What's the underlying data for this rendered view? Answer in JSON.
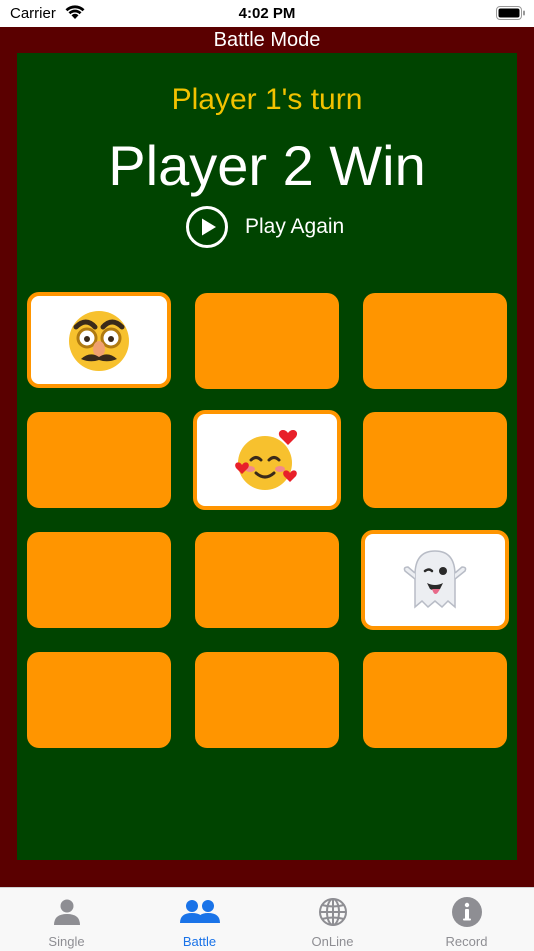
{
  "status_bar": {
    "carrier": "Carrier",
    "time": "4:02 PM"
  },
  "title": "Battle Mode",
  "game": {
    "turn_text": "Player 1's turn",
    "result_text": "Player 2 Win",
    "play_again_label": "Play Again"
  },
  "cards": [
    {
      "face": "disguised-face-emoji",
      "revealed": true
    },
    {
      "face": "hidden",
      "revealed": false
    },
    {
      "face": "hidden",
      "revealed": false
    },
    {
      "face": "hidden",
      "revealed": false
    },
    {
      "face": "smiling-face-with-hearts-emoji",
      "revealed": true
    },
    {
      "face": "hidden",
      "revealed": false
    },
    {
      "face": "hidden",
      "revealed": false
    },
    {
      "face": "hidden",
      "revealed": false
    },
    {
      "face": "ghost-emoji",
      "revealed": true
    },
    {
      "face": "hidden",
      "revealed": false
    },
    {
      "face": "hidden",
      "revealed": false
    },
    {
      "face": "hidden",
      "revealed": false
    }
  ],
  "tabs": [
    {
      "label": "Single",
      "icon": "person-icon",
      "active": false
    },
    {
      "label": "Battle",
      "icon": "two-people-icon",
      "active": true
    },
    {
      "label": "OnLine",
      "icon": "globe-icon",
      "active": false
    },
    {
      "label": "Record",
      "icon": "info-icon",
      "active": false
    }
  ],
  "colors": {
    "frame": "#5a0000",
    "board": "#004400",
    "card": "#ff9500",
    "turn_text": "#f2c200",
    "active_tab": "#1a73e8"
  }
}
